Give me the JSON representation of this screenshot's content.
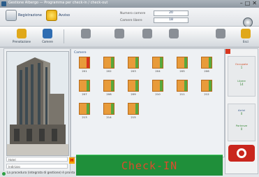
{
  "window": {
    "title": "Gestione Albergo — Programma per check-in / check-out",
    "controls": [
      "–",
      "□",
      "✕"
    ]
  },
  "header": {
    "link_left": "Registrazione",
    "link_right": "Avviso",
    "fields": [
      {
        "label": "Numero camere",
        "value": "20"
      },
      {
        "label": "Camere libere",
        "value": "18"
      }
    ]
  },
  "toolbar": {
    "buttons": [
      {
        "label": "Prenotazione",
        "icon": "booking-icon",
        "color": "#e0a81a"
      },
      {
        "label": "Camere",
        "icon": "rooms-icon",
        "color": "#2f6db2"
      },
      {
        "label": "",
        "icon": "guest-icon",
        "color": "#8a8f96"
      },
      {
        "label": "",
        "icon": "guests-icon",
        "color": "#8a8f96"
      },
      {
        "label": "",
        "icon": "staff-icon",
        "color": "#8a8f96"
      },
      {
        "label": "",
        "icon": "cards-icon",
        "color": "#8a8f96"
      },
      {
        "label": "",
        "icon": "settings-icon",
        "color": "#8a8f96"
      },
      {
        "label": "Esci",
        "icon": "lock-icon",
        "color": "#e0a81a"
      }
    ]
  },
  "left_panel": {
    "hotel_name": "Hotel",
    "address": "Indirizzo"
  },
  "main": {
    "section_label": "Camere",
    "rooms": [
      {
        "number": "201",
        "status": "occupied"
      },
      {
        "number": "202",
        "status": "free"
      },
      {
        "number": "203",
        "status": "free"
      },
      {
        "number": "204",
        "status": "free"
      },
      {
        "number": "205",
        "status": "free"
      },
      {
        "number": "206",
        "status": "free"
      },
      {
        "number": "207",
        "status": "free"
      },
      {
        "number": "208",
        "status": "free"
      },
      {
        "number": "209",
        "status": "free"
      },
      {
        "number": "210",
        "status": "free"
      },
      {
        "number": "211",
        "status": "free"
      },
      {
        "number": "212",
        "status": "free"
      },
      {
        "number": "213",
        "status": "free"
      },
      {
        "number": "214",
        "status": "free"
      },
      {
        "number": "215",
        "status": "free"
      }
    ]
  },
  "right_panel": {
    "box1": {
      "label": "Occupate",
      "value": "1"
    },
    "box2": {
      "label": "Libere",
      "value": "14"
    },
    "box3": {
      "label": "Arrivi",
      "value": "0"
    },
    "box4": {
      "label": "Partenze",
      "value": "0"
    },
    "exit_icon": "help-icon"
  },
  "checkin": {
    "label": "Check-IN"
  },
  "statusbar": {
    "message": "La procedura (integrata di gestione) è pronta"
  }
}
